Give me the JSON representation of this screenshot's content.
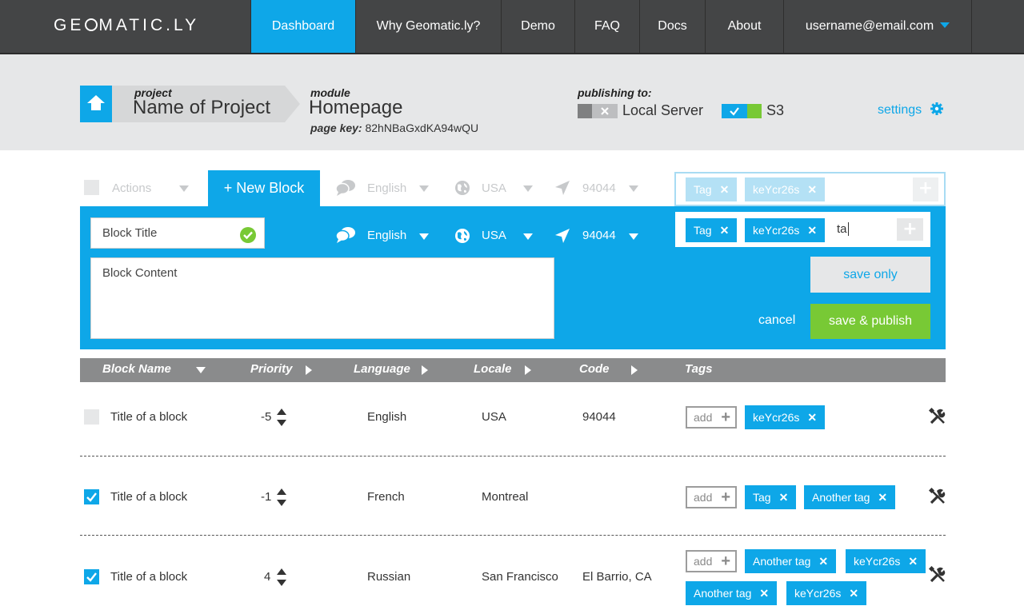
{
  "brand": {
    "logo_left": "GE",
    "logo_right": "MATIC.LY"
  },
  "nav": {
    "items": [
      "Dashboard",
      "Why Geomatic.ly?",
      "Demo",
      "FAQ",
      "Docs",
      "About"
    ],
    "user": "username@email.com"
  },
  "project": {
    "project_label": "project",
    "project_name": "Name of Project",
    "module_label": "module",
    "module_name": "Homepage",
    "pagekey_label": "page key:",
    "pagekey_value": "82hNBaGxdKA94wQU",
    "publishing_label": "publishing to:",
    "targets": [
      {
        "name": "Local Server",
        "enabled": false
      },
      {
        "name": "S3",
        "enabled": true
      }
    ],
    "settings_label": "settings"
  },
  "toolbar": {
    "actions_label": "Actions",
    "new_block_label": "+ New Block",
    "language": "English",
    "locale": "USA",
    "code": "94044",
    "ghost_tags": [
      "Tag",
      "keYcr26s"
    ]
  },
  "editor": {
    "title_value": "Block Title",
    "content_value": "Block Content",
    "language": "English",
    "locale": "USA",
    "code": "94044",
    "tags": [
      "Tag",
      "keYcr26s"
    ],
    "tag_input_value": "ta",
    "save_only_label": "save only",
    "cancel_label": "cancel",
    "save_publish_label": "save & publish"
  },
  "table": {
    "columns": [
      "Block Name",
      "Priority",
      "Language",
      "Locale",
      "Code",
      "Tags"
    ],
    "add_label": "add",
    "rows": [
      {
        "checked": false,
        "name": "Title of a block",
        "priority": "-5",
        "language": "English",
        "locale": "USA",
        "code": "94044",
        "tags": [
          "keYcr26s"
        ]
      },
      {
        "checked": true,
        "name": "Title of a block",
        "priority": "-1",
        "language": "French",
        "locale": "Montreal",
        "code": "",
        "tags": [
          "Tag",
          "Another tag"
        ]
      },
      {
        "checked": true,
        "name": "Title of a block",
        "priority": "4",
        "language": "Russian",
        "locale": "San Francisco",
        "code": "El Barrio, CA",
        "tags": [
          "Another tag",
          "keYcr26s",
          "Another tag",
          "keYcr26s"
        ]
      }
    ]
  },
  "colors": {
    "accent": "#0ea7e8",
    "green": "#78c935",
    "nav_bg": "#444546",
    "header_bg": "#e6e7e8"
  }
}
